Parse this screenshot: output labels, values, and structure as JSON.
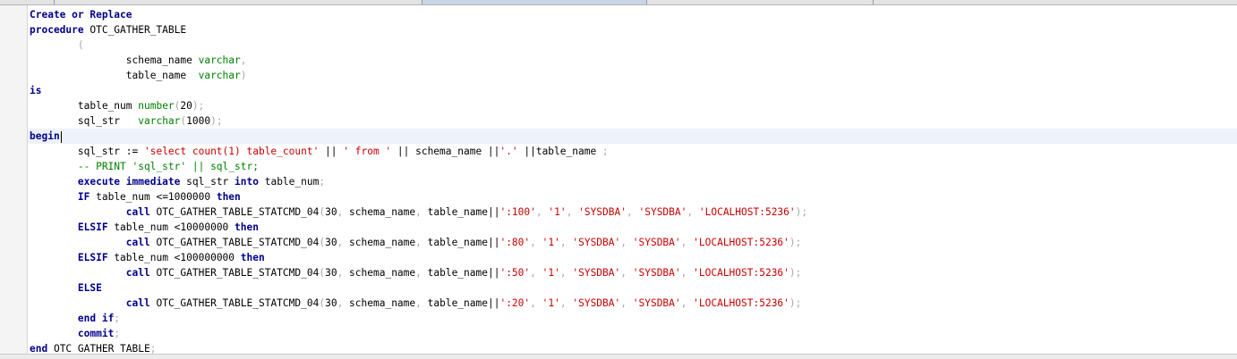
{
  "colors": {
    "keyword": "#00008b",
    "type": "#008000",
    "string": "#c80000",
    "punctuation": "#a8a8a8",
    "comment": "#008000",
    "current_line": "#eef2fb"
  },
  "editor": {
    "current_line": 8,
    "lines": [
      [
        [
          "kw",
          "Create or Replace"
        ]
      ],
      [
        [
          "kw",
          "procedure"
        ],
        [
          "id",
          " OTC_GATHER_TABLE"
        ]
      ],
      [
        [
          "id",
          "        "
        ],
        [
          "pun",
          "("
        ]
      ],
      [
        [
          "id",
          "                schema_name "
        ],
        [
          "ty",
          "varchar"
        ],
        [
          "pun",
          ","
        ]
      ],
      [
        [
          "id",
          "                table_name  "
        ],
        [
          "ty",
          "varchar"
        ],
        [
          "pun",
          ")"
        ]
      ],
      [
        [
          "kw",
          "is"
        ]
      ],
      [
        [
          "id",
          "        table_num "
        ],
        [
          "ty",
          "number"
        ],
        [
          "pun",
          "("
        ],
        [
          "num",
          "20"
        ],
        [
          "pun",
          ");"
        ]
      ],
      [
        [
          "id",
          "        sql_str   "
        ],
        [
          "ty",
          "varchar"
        ],
        [
          "pun",
          "("
        ],
        [
          "num",
          "1000"
        ],
        [
          "pun",
          ");"
        ]
      ],
      [
        [
          "kw",
          "begin"
        ]
      ],
      [
        [
          "id",
          "        sql_str := "
        ],
        [
          "str",
          "'select count(1) table_count'"
        ],
        [
          "id",
          " || "
        ],
        [
          "str",
          "' from '"
        ],
        [
          "id",
          " || schema_name ||"
        ],
        [
          "str",
          "'.'"
        ],
        [
          "id",
          " ||table_name "
        ],
        [
          "pun",
          ";"
        ]
      ],
      [
        [
          "cm",
          "        -- PRINT 'sql_str' || sql_str;"
        ]
      ],
      [
        [
          "id",
          "        "
        ],
        [
          "kw",
          "execute immediate"
        ],
        [
          "id",
          " sql_str "
        ],
        [
          "kw",
          "into"
        ],
        [
          "id",
          " table_num"
        ],
        [
          "pun",
          ";"
        ]
      ],
      [
        [
          "id",
          "        "
        ],
        [
          "kw",
          "IF"
        ],
        [
          "id",
          " table_num <=1000000 "
        ],
        [
          "kw",
          "then"
        ]
      ],
      [
        [
          "id",
          "                "
        ],
        [
          "kw",
          "call"
        ],
        [
          "id",
          " OTC_GATHER_TABLE_STATCMD_04"
        ],
        [
          "pun",
          "("
        ],
        [
          "num",
          "30"
        ],
        [
          "pun",
          ","
        ],
        [
          "id",
          " schema_name"
        ],
        [
          "pun",
          ","
        ],
        [
          "id",
          " table_name||"
        ],
        [
          "str",
          "':100'"
        ],
        [
          "pun",
          ","
        ],
        [
          "id",
          " "
        ],
        [
          "str",
          "'1'"
        ],
        [
          "pun",
          ","
        ],
        [
          "id",
          " "
        ],
        [
          "str",
          "'SYSDBA'"
        ],
        [
          "pun",
          ","
        ],
        [
          "id",
          " "
        ],
        [
          "str",
          "'SYSDBA'"
        ],
        [
          "pun",
          ","
        ],
        [
          "id",
          " "
        ],
        [
          "str",
          "'LOCALHOST:5236'"
        ],
        [
          "pun",
          ");"
        ]
      ],
      [
        [
          "id",
          "        "
        ],
        [
          "kw",
          "ELSIF"
        ],
        [
          "id",
          " table_num <10000000 "
        ],
        [
          "kw",
          "then"
        ]
      ],
      [
        [
          "id",
          "                "
        ],
        [
          "kw",
          "call"
        ],
        [
          "id",
          " OTC_GATHER_TABLE_STATCMD_04"
        ],
        [
          "pun",
          "("
        ],
        [
          "num",
          "30"
        ],
        [
          "pun",
          ","
        ],
        [
          "id",
          " schema_name"
        ],
        [
          "pun",
          ","
        ],
        [
          "id",
          " table_name||"
        ],
        [
          "str",
          "':80'"
        ],
        [
          "pun",
          ","
        ],
        [
          "id",
          " "
        ],
        [
          "str",
          "'1'"
        ],
        [
          "pun",
          ","
        ],
        [
          "id",
          " "
        ],
        [
          "str",
          "'SYSDBA'"
        ],
        [
          "pun",
          ","
        ],
        [
          "id",
          " "
        ],
        [
          "str",
          "'SYSDBA'"
        ],
        [
          "pun",
          ","
        ],
        [
          "id",
          " "
        ],
        [
          "str",
          "'LOCALHOST:5236'"
        ],
        [
          "pun",
          ");"
        ]
      ],
      [
        [
          "id",
          "        "
        ],
        [
          "kw",
          "ELSIF"
        ],
        [
          "id",
          " table_num <100000000 "
        ],
        [
          "kw",
          "then"
        ]
      ],
      [
        [
          "id",
          "                "
        ],
        [
          "kw",
          "call"
        ],
        [
          "id",
          " OTC_GATHER_TABLE_STATCMD_04"
        ],
        [
          "pun",
          "("
        ],
        [
          "num",
          "30"
        ],
        [
          "pun",
          ","
        ],
        [
          "id",
          " schema_name"
        ],
        [
          "pun",
          ","
        ],
        [
          "id",
          " table_name||"
        ],
        [
          "str",
          "':50'"
        ],
        [
          "pun",
          ","
        ],
        [
          "id",
          " "
        ],
        [
          "str",
          "'1'"
        ],
        [
          "pun",
          ","
        ],
        [
          "id",
          " "
        ],
        [
          "str",
          "'SYSDBA'"
        ],
        [
          "pun",
          ","
        ],
        [
          "id",
          " "
        ],
        [
          "str",
          "'SYSDBA'"
        ],
        [
          "pun",
          ","
        ],
        [
          "id",
          " "
        ],
        [
          "str",
          "'LOCALHOST:5236'"
        ],
        [
          "pun",
          ");"
        ]
      ],
      [
        [
          "id",
          "        "
        ],
        [
          "kw",
          "ELSE"
        ]
      ],
      [
        [
          "id",
          "                "
        ],
        [
          "kw",
          "call"
        ],
        [
          "id",
          " OTC_GATHER_TABLE_STATCMD_04"
        ],
        [
          "pun",
          "("
        ],
        [
          "num",
          "30"
        ],
        [
          "pun",
          ","
        ],
        [
          "id",
          " schema_name"
        ],
        [
          "pun",
          ","
        ],
        [
          "id",
          " table_name||"
        ],
        [
          "str",
          "':20'"
        ],
        [
          "pun",
          ","
        ],
        [
          "id",
          " "
        ],
        [
          "str",
          "'1'"
        ],
        [
          "pun",
          ","
        ],
        [
          "id",
          " "
        ],
        [
          "str",
          "'SYSDBA'"
        ],
        [
          "pun",
          ","
        ],
        [
          "id",
          " "
        ],
        [
          "str",
          "'SYSDBA'"
        ],
        [
          "pun",
          ","
        ],
        [
          "id",
          " "
        ],
        [
          "str",
          "'LOCALHOST:5236'"
        ],
        [
          "pun",
          ");"
        ]
      ],
      [
        [
          "id",
          "        "
        ],
        [
          "kw",
          "end if"
        ],
        [
          "pun",
          ";"
        ]
      ],
      [
        [
          "id",
          "        "
        ],
        [
          "kw",
          "commit"
        ],
        [
          "pun",
          ";"
        ]
      ],
      [
        [
          "kw",
          "end"
        ],
        [
          "id",
          " OTC_GATHER_TABLE"
        ],
        [
          "pun",
          ";"
        ]
      ]
    ]
  }
}
